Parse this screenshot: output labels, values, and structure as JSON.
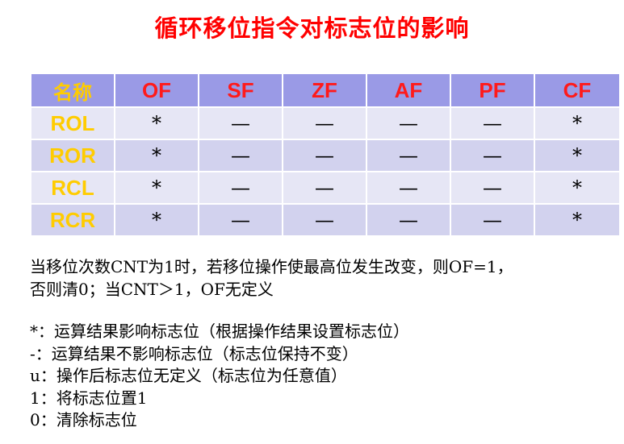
{
  "title": "循环移位指令对标志位的影响",
  "table": {
    "headers": [
      "名称",
      "OF",
      "SF",
      "ZF",
      "AF",
      "PF",
      "CF"
    ],
    "rows": [
      {
        "name": "ROL",
        "cells": [
          "*",
          "—",
          "—",
          "—",
          "—",
          "*"
        ]
      },
      {
        "name": "ROR",
        "cells": [
          "*",
          "—",
          "—",
          "—",
          "—",
          "*"
        ]
      },
      {
        "name": "RCL",
        "cells": [
          "*",
          "—",
          "—",
          "—",
          "—",
          "*"
        ]
      },
      {
        "name": "RCR",
        "cells": [
          "*",
          "—",
          "—",
          "—",
          "—",
          "*"
        ]
      }
    ]
  },
  "note": {
    "line1": "当移位次数CNT为1时，若移位操作使最高位发生改变，则OF=1，",
    "line2": "否则清0；当CNT＞1，OF无定义"
  },
  "legend": [
    "*：运算结果影响标志位（根据操作结果设置标志位）",
    "-：运算结果不影响标志位（标志位保持不变）",
    "u：操作后标志位无定义（标志位为任意值）",
    "1：将标志位置1",
    "0：清除标志位"
  ],
  "colors": {
    "title": "#ff0000",
    "header_bg": "#9a9ae6",
    "row_bg": "#e6e6f5",
    "row_alt_bg": "#d2d2ee",
    "header_text": "#ff1a1a",
    "name_text": "#ffcc00"
  }
}
